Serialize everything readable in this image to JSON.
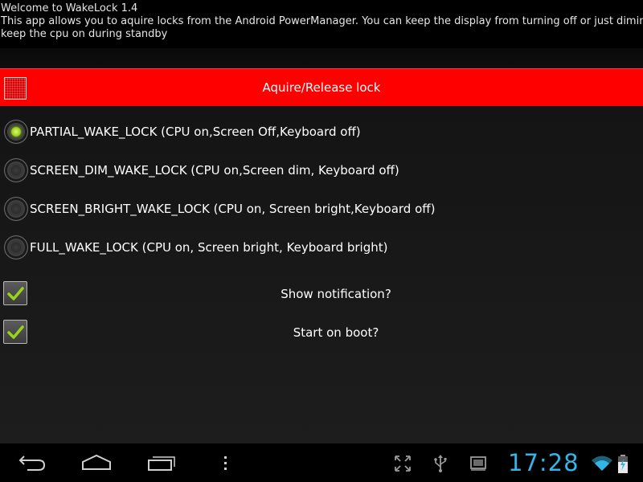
{
  "header": {
    "line1": "Welcome to WakeLock 1.4",
    "line2": "This app allows you to aquire locks from the Android PowerManager. You can keep the display from turning off or just diming or",
    "line3": "keep the cpu on during standby"
  },
  "lock_toggle": {
    "label": "Aquire/Release lock",
    "checked": false,
    "color": "#fe0000"
  },
  "lock_types": [
    {
      "label": "PARTIAL_WAKE_LOCK (CPU on,Screen Off,Keyboard off)",
      "selected": true
    },
    {
      "label": "SCREEN_DIM_WAKE_LOCK (CPU on,Screen dim, Keyboard off)",
      "selected": false
    },
    {
      "label": "SCREEN_BRIGHT_WAKE_LOCK (CPU on, Screen bright,Keyboard off)",
      "selected": false
    },
    {
      "label": "FULL_WAKE_LOCK (CPU on, Screen bright, Keyboard bright)",
      "selected": false
    }
  ],
  "options": [
    {
      "label": "Show notification?",
      "checked": true
    },
    {
      "label": "Start on boot?",
      "checked": true
    }
  ],
  "system_bar": {
    "nav_icons": [
      "back-icon",
      "home-icon",
      "recent-apps-icon",
      "menu-icon"
    ],
    "status_icons": [
      "screen-compat-icon",
      "usb-icon",
      "debug-icon",
      "wifi-icon",
      "battery-charging-icon"
    ],
    "clock": "17:28",
    "accent": "#33b5e5"
  }
}
